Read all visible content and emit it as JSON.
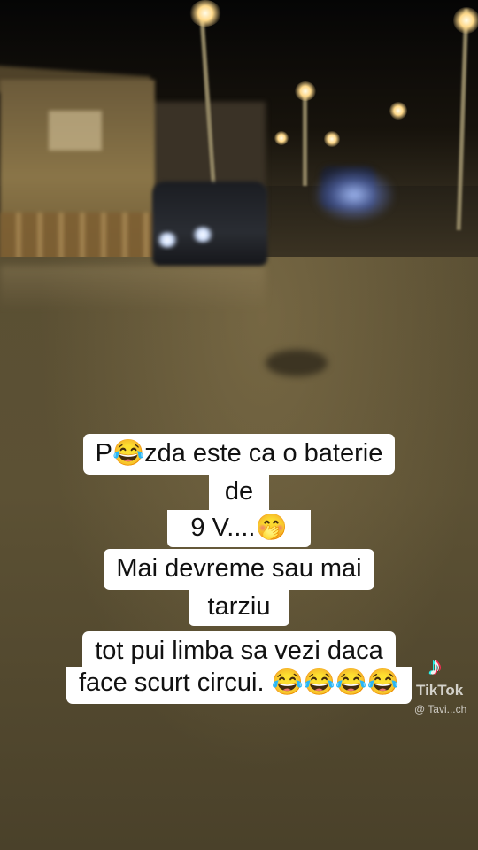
{
  "caption": {
    "lines": [
      "P😂zda este ca o baterie",
      "de",
      "9 V....🤭",
      "Mai devreme sau mai",
      "tarziu",
      "tot pui limba sa vezi daca",
      "face scurt circui. 😂😂😂😂"
    ]
  },
  "watermark": {
    "brand": "TikTok",
    "handle": "@ Tavi...ch",
    "icon": "tiktok-note-icon"
  }
}
